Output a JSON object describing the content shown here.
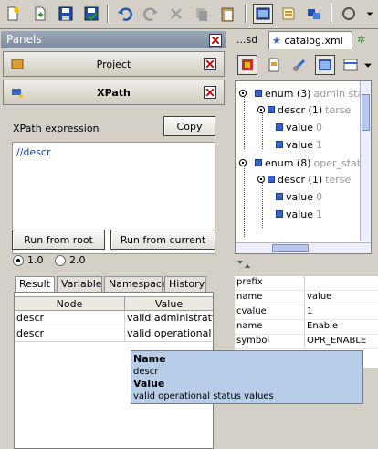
{
  "toolbar": {
    "icons": [
      "new-file-icon",
      "add-file-icon",
      "save-icon",
      "save-all-icon",
      "undo-icon",
      "redo-icon",
      "cut-icon",
      "copy-icon",
      "paste-icon",
      "toggle-view-icon",
      "notes-icon",
      "compare-icon",
      "refresh-icon"
    ]
  },
  "panels": {
    "header": "Panels",
    "project_label": "Project",
    "xpath_label": "XPath"
  },
  "xpath": {
    "expression_label": "XPath expression",
    "copy_label": "Copy",
    "expression": "//descr",
    "run_root_label": "Run from root",
    "run_current_label": "Run from current",
    "version_options": [
      "1.0",
      "2.0"
    ],
    "selected_version": "1.0"
  },
  "result_tabs": [
    "Result",
    "Variable",
    "Namespace",
    "History"
  ],
  "result_table": {
    "columns": [
      "Node",
      "Value"
    ],
    "rows": [
      {
        "node": "descr",
        "value": "valid administratve..."
      },
      {
        "node": "descr",
        "value": "valid operational st..."
      }
    ]
  },
  "tooltip": {
    "name_label": "Name",
    "name_value": "descr",
    "value_label": "Value",
    "value_value": "valid operational status values"
  },
  "file_tabs": [
    {
      "label": "...sd"
    },
    {
      "label": "catalog.xml"
    }
  ],
  "tree": [
    {
      "label": "enum (3)",
      "dim": "admin state"
    },
    {
      "label": "descr (1)",
      "dim": "terse"
    },
    {
      "label": "value",
      "dim": "0"
    },
    {
      "label": "value",
      "dim": "1"
    },
    {
      "label": "enum (8)",
      "dim": "oper_statu"
    },
    {
      "label": "descr (1)",
      "dim": "terse"
    },
    {
      "label": "value",
      "dim": "0"
    },
    {
      "label": "value",
      "dim": "1"
    }
  ],
  "properties": [
    {
      "key": "prefix",
      "value": ""
    },
    {
      "key": "name",
      "value": "value"
    },
    {
      "key": "cvalue",
      "value": "1"
    },
    {
      "key": "name",
      "value": "Enable"
    },
    {
      "key": "symbol",
      "value": "OPR_ENABLE"
    }
  ]
}
